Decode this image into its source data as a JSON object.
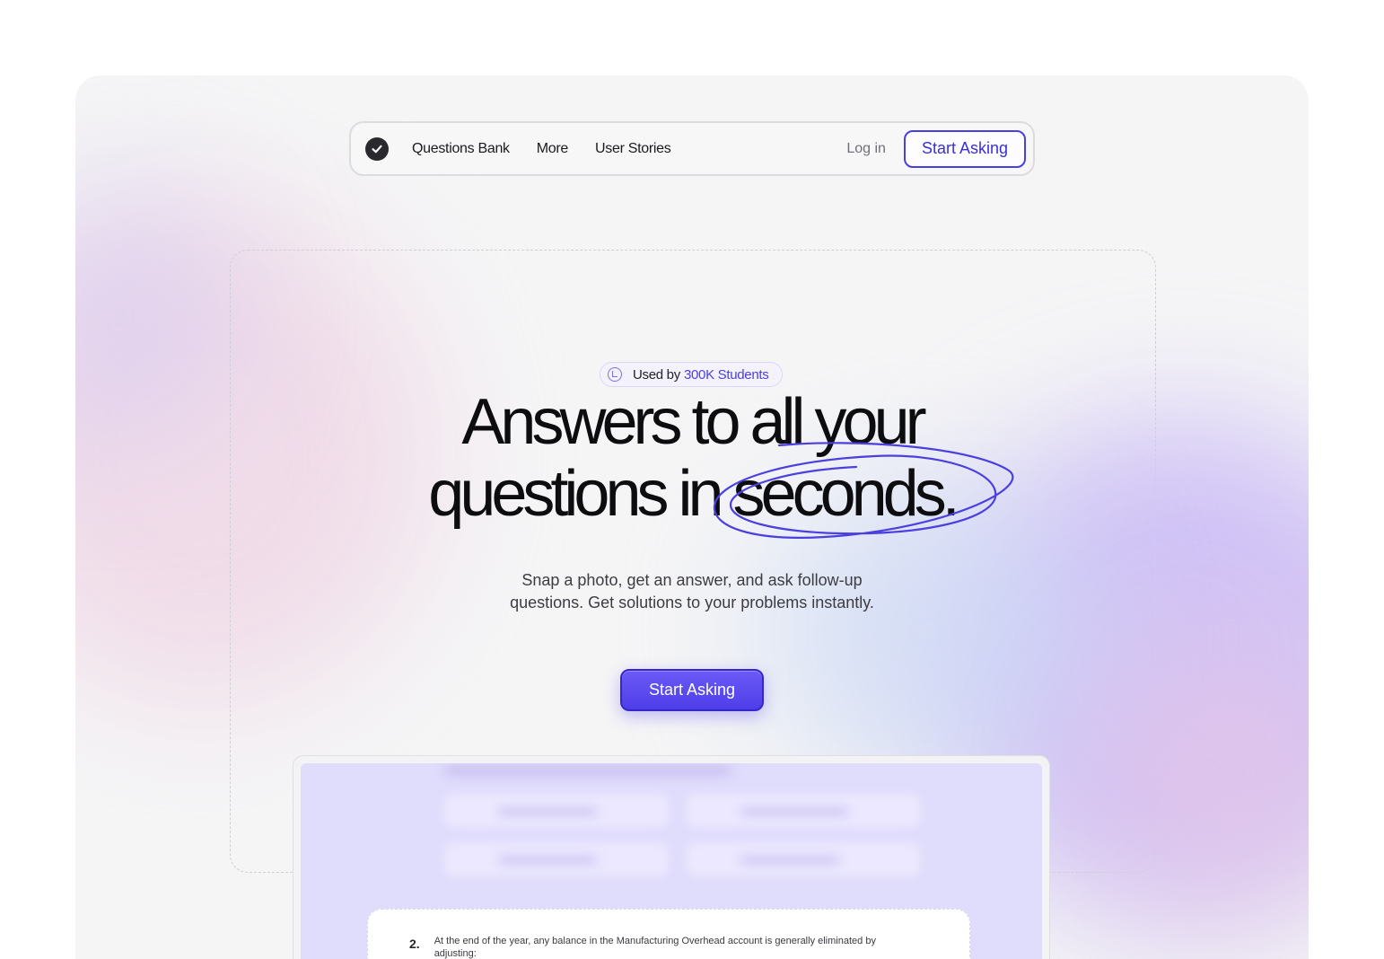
{
  "nav": {
    "links": [
      "Questions Bank",
      "More",
      "User Stories"
    ],
    "login": "Log in",
    "cta": "Start Asking"
  },
  "hero": {
    "badge_prefix": "Used by",
    "badge_highlight": "300K Students",
    "headline_line1": "Answers to all your",
    "headline_line2": "questions in seconds.",
    "subtitle_line1": "Snap a photo, get an answer, and ask follow-up",
    "subtitle_line2": "questions. Get solutions to your problems instantly.",
    "cta": "Start Asking"
  },
  "preview": {
    "question_number": "2.",
    "question_text": "At the end of the year, any balance in the Manufacturing Overhead account is generally eliminated by adjusting:"
  },
  "colors": {
    "accent": "#4b3fe0",
    "button_gradient_top": "#6b5af6",
    "button_gradient_bottom": "#4f3ee8",
    "preview_bg": "#e0dcfc"
  },
  "icons": {
    "logo": "check-circle-icon",
    "badge": "chart-icon"
  }
}
